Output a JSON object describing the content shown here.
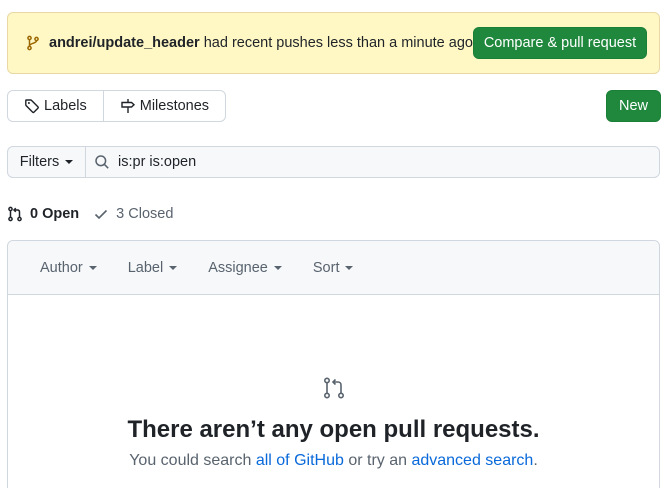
{
  "banner": {
    "branch": "andrei/update_header",
    "message": "had recent pushes less than a minute ago",
    "button_label": "Compare & pull request"
  },
  "nav": {
    "labels_label": "Labels",
    "milestones_label": "Milestones",
    "new_label": "New"
  },
  "filter": {
    "filters_label": "Filters",
    "query": "is:pr is:open"
  },
  "states": {
    "open_label": "0 Open",
    "closed_label": "3 Closed"
  },
  "table_header": {
    "author": "Author",
    "label": "Label",
    "assignee": "Assignee",
    "sort": "Sort"
  },
  "blankslate": {
    "title": "There aren’t any open pull requests.",
    "text_before": "You could search ",
    "link1": "all of GitHub",
    "text_middle": " or try an ",
    "link2": "advanced search",
    "text_after": "."
  },
  "colors": {
    "banner_bg": "#fff8c5",
    "primary_green": "#1f883d",
    "link_blue": "#0969da",
    "muted": "#59636e",
    "branch_icon": "#9a6700"
  },
  "icons": [
    "git-branch-icon",
    "tag-icon",
    "milestone-icon",
    "search-icon",
    "git-pull-request-icon",
    "check-icon"
  ]
}
